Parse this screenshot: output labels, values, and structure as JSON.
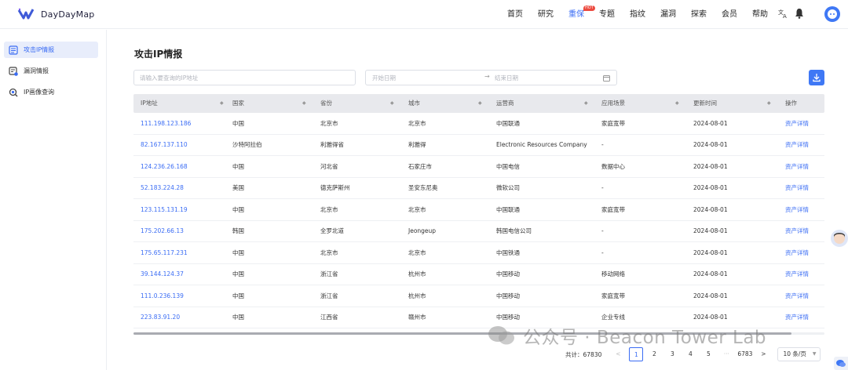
{
  "app": {
    "brand": "DayDayMap"
  },
  "nav": {
    "items": [
      {
        "label": "首页"
      },
      {
        "label": "研究"
      },
      {
        "label": "重保",
        "badge": "HOT"
      },
      {
        "label": "专题"
      },
      {
        "label": "指纹"
      },
      {
        "label": "漏洞"
      },
      {
        "label": "探索"
      },
      {
        "label": "会员"
      },
      {
        "label": "帮助"
      }
    ],
    "active": "重保"
  },
  "sidebar": {
    "items": [
      {
        "label": "攻击IP情报",
        "icon": "report-icon"
      },
      {
        "label": "漏洞情报",
        "icon": "vulnerability-icon"
      },
      {
        "label": "IP画像查询",
        "icon": "search-icon"
      }
    ],
    "active_index": 0
  },
  "page": {
    "title": "攻击IP情报"
  },
  "filters": {
    "search_placeholder": "请输入要查询的IP地址",
    "start_date_placeholder": "开始日期",
    "end_date_placeholder": "结束日期",
    "date_separator": "→"
  },
  "table": {
    "columns": [
      "IP地址",
      "国家",
      "省份",
      "城市",
      "运营商",
      "应用场景",
      "更新时间",
      "操作"
    ],
    "rows": [
      [
        "111.198.123.186",
        "中国",
        "北京市",
        "北京市",
        "中国联通",
        "家庭宽带",
        "2024-08-01",
        "资产详情"
      ],
      [
        "82.167.137.110",
        "沙特阿拉伯",
        "利雅得省",
        "利雅得",
        "Electronic Resources Company",
        "-",
        "2024-08-01",
        "资产详情"
      ],
      [
        "124.236.26.168",
        "中国",
        "河北省",
        "石家庄市",
        "中国电信",
        "数据中心",
        "2024-08-01",
        "资产详情"
      ],
      [
        "52.183.224.28",
        "美国",
        "德克萨斯州",
        "圣安东尼奥",
        "微软公司",
        "-",
        "2024-08-01",
        "资产详情"
      ],
      [
        "123.115.131.19",
        "中国",
        "北京市",
        "北京市",
        "中国联通",
        "家庭宽带",
        "2024-08-01",
        "资产详情"
      ],
      [
        "175.202.66.13",
        "韩国",
        "全罗北道",
        "Jeongeup",
        "韩国电信公司",
        "-",
        "2024-08-01",
        "资产详情"
      ],
      [
        "175.65.117.231",
        "中国",
        "北京市",
        "北京市",
        "中国铁通",
        "-",
        "2024-08-01",
        "资产详情"
      ],
      [
        "39.144.124.37",
        "中国",
        "浙江省",
        "杭州市",
        "中国移动",
        "移动网络",
        "2024-08-01",
        "资产详情"
      ],
      [
        "111.0.236.139",
        "中国",
        "浙江省",
        "杭州市",
        "中国移动",
        "家庭宽带",
        "2024-08-01",
        "资产详情"
      ],
      [
        "223.83.91.20",
        "中国",
        "江西省",
        "赣州市",
        "中国移动",
        "企业专线",
        "2024-08-01",
        "资产详情"
      ]
    ]
  },
  "pagination": {
    "total_text": "共计：67830",
    "prev": "<",
    "next": ">",
    "pages": [
      "1",
      "2",
      "3",
      "4",
      "5",
      "···",
      "6783"
    ],
    "current": "1",
    "page_size": "10 条/页"
  },
  "watermark": {
    "text": "公众号 · Beacon Tower Lab"
  },
  "colors": {
    "accent": "#3a6cf4",
    "header_bg": "#e8e9ed",
    "button_bg": "#3f78f5"
  }
}
